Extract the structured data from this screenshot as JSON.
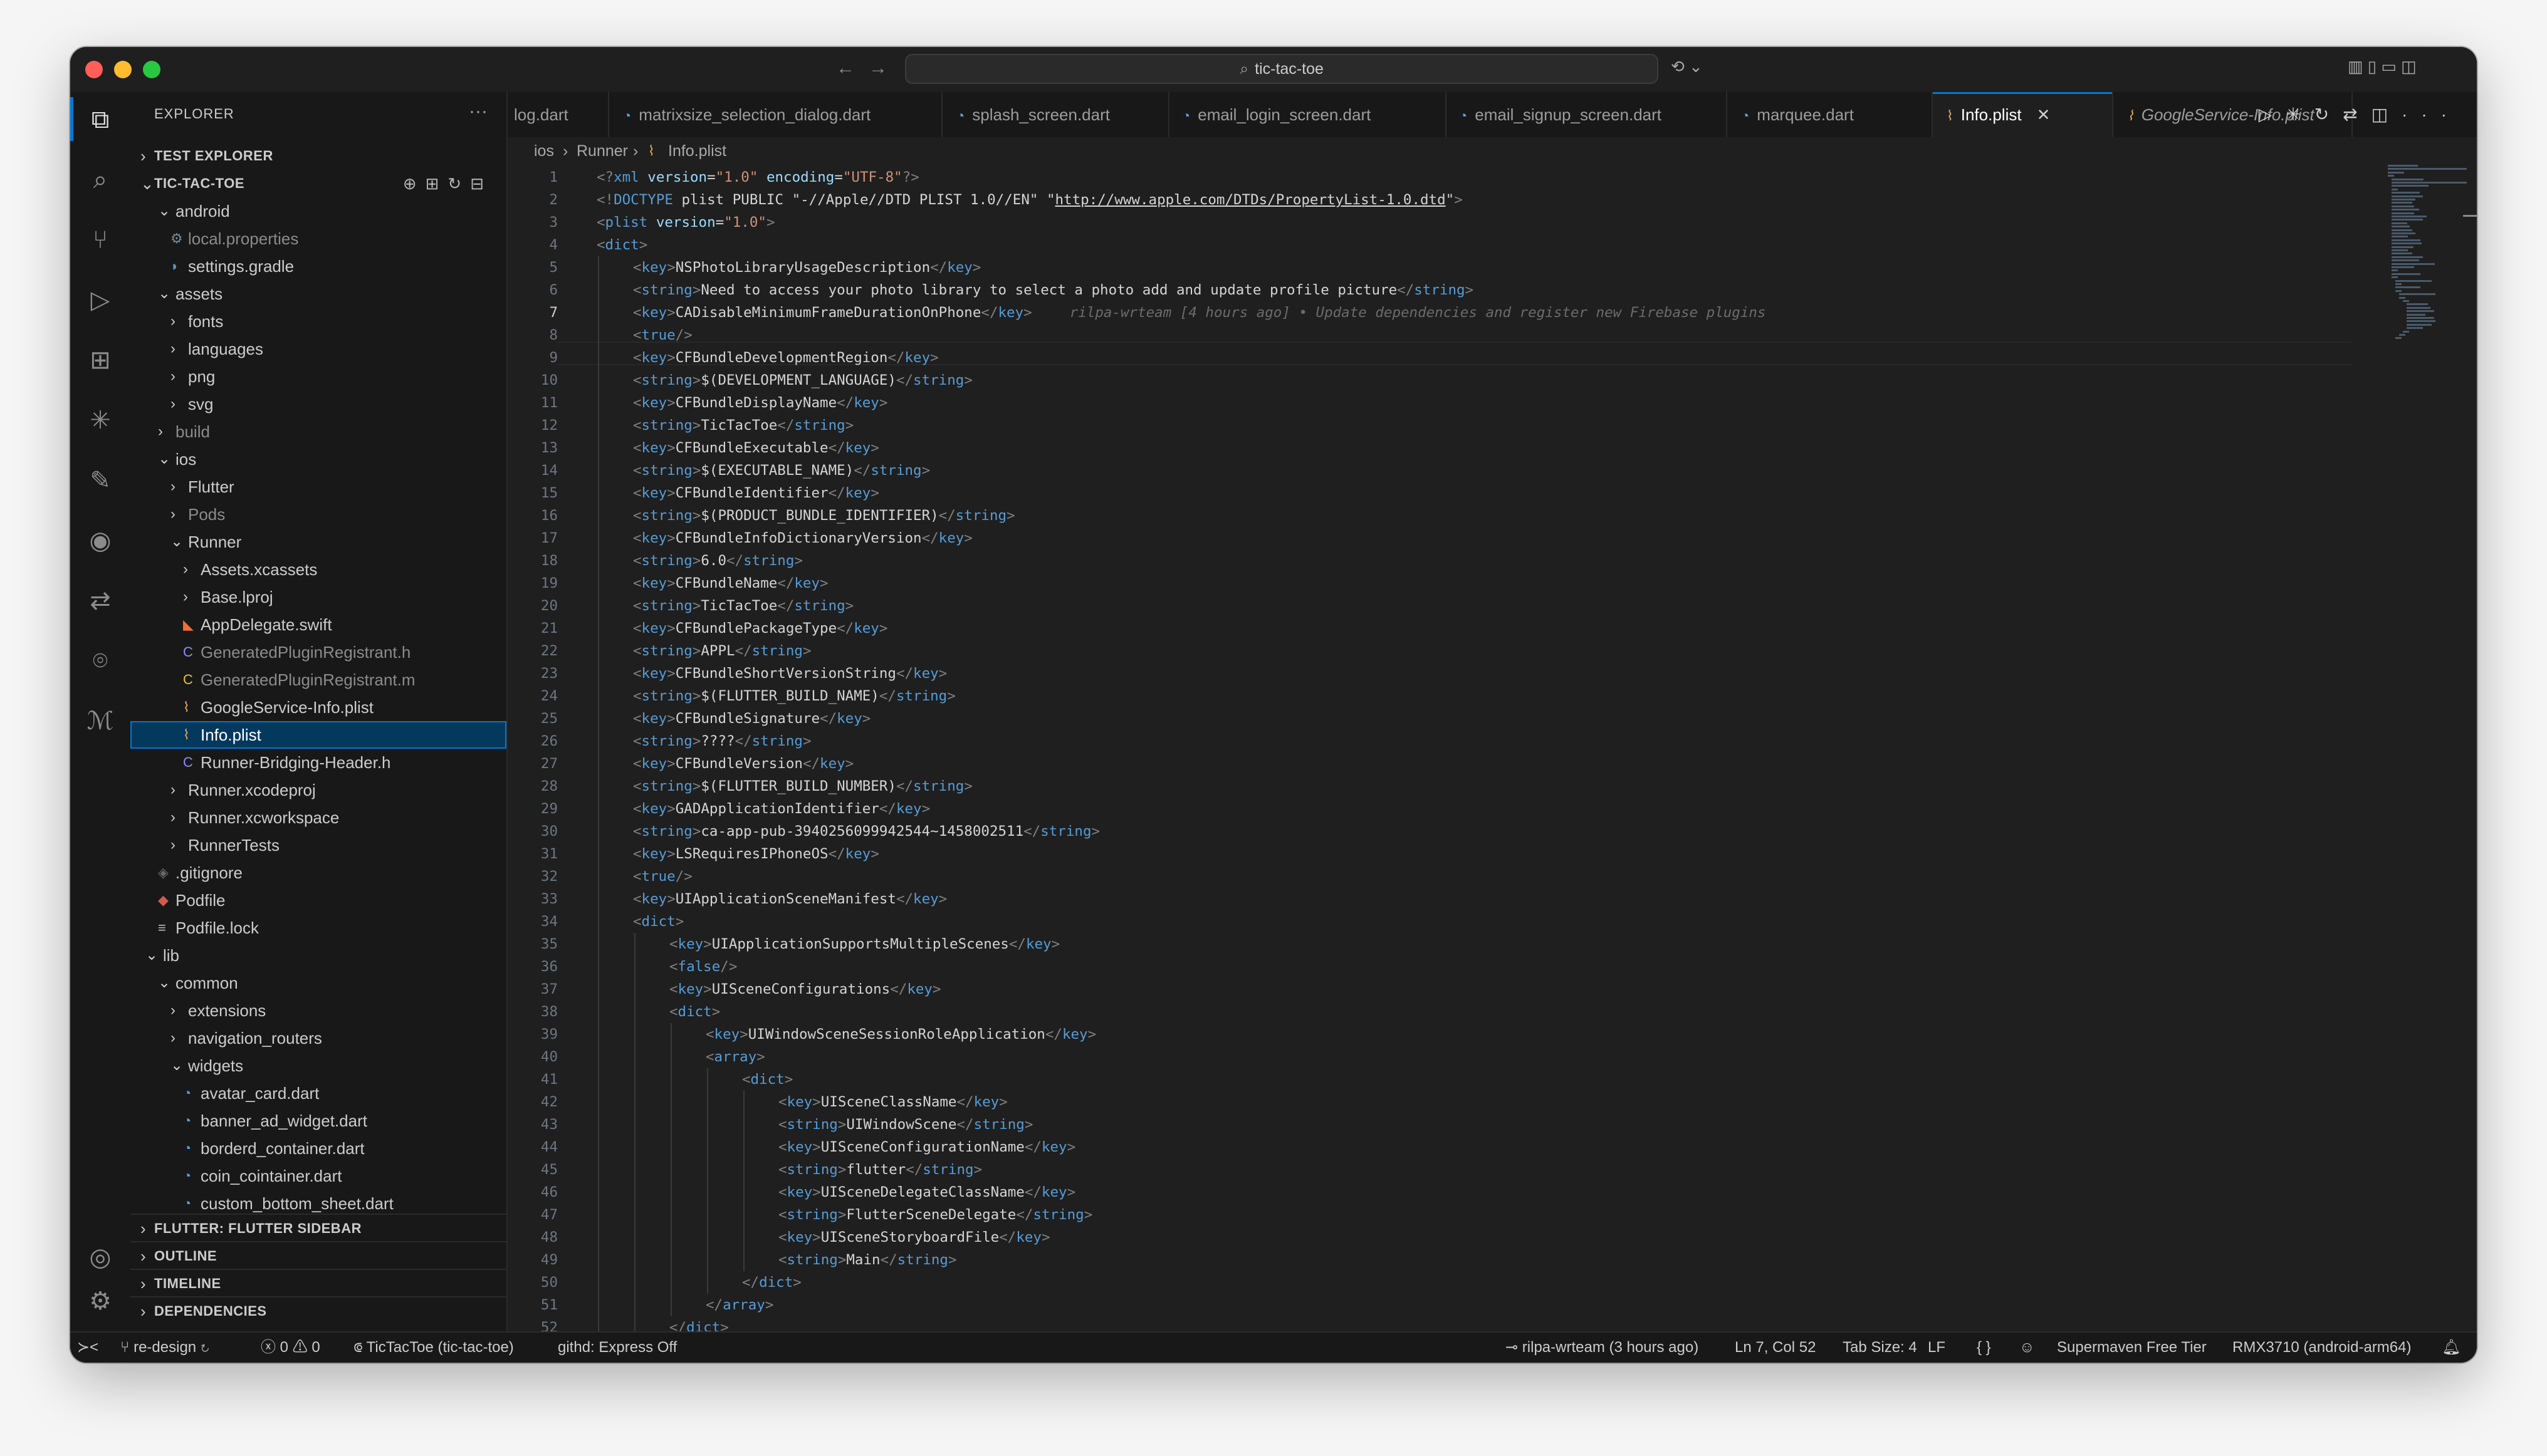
{
  "window": {
    "search": "tic-tac-toe"
  },
  "sidebar": {
    "title": "EXPLORER",
    "sections": {
      "test_explorer": "TEST EXPLORER",
      "project": "TIC-TAC-TOE",
      "flutter_sidebar": "FLUTTER: FLUTTER SIDEBAR",
      "outline": "OUTLINE",
      "timeline": "TIMELINE",
      "dependencies": "DEPENDENCIES"
    },
    "tree": [
      {
        "name": "android",
        "type": "folder-open",
        "depth": 0
      },
      {
        "name": "local.properties",
        "type": "gear-file",
        "depth": 1,
        "dim": true
      },
      {
        "name": "settings.gradle",
        "type": "gradle-file",
        "depth": 1
      },
      {
        "name": "assets",
        "type": "folder-open",
        "depth": 0
      },
      {
        "name": "fonts",
        "type": "folder",
        "depth": 1
      },
      {
        "name": "languages",
        "type": "folder",
        "depth": 1
      },
      {
        "name": "png",
        "type": "folder",
        "depth": 1
      },
      {
        "name": "svg",
        "type": "folder",
        "depth": 1
      },
      {
        "name": "build",
        "type": "folder",
        "depth": 0,
        "dim": true
      },
      {
        "name": "ios",
        "type": "folder-open",
        "depth": 0
      },
      {
        "name": "Flutter",
        "type": "folder",
        "depth": 1
      },
      {
        "name": "Pods",
        "type": "folder",
        "depth": 1,
        "dim": true
      },
      {
        "name": "Runner",
        "type": "folder-open",
        "depth": 1
      },
      {
        "name": "Assets.xcassets",
        "type": "folder",
        "depth": 2
      },
      {
        "name": "Base.lproj",
        "type": "folder",
        "depth": 2
      },
      {
        "name": "AppDelegate.swift",
        "type": "swift-file",
        "depth": 2
      },
      {
        "name": "GeneratedPluginRegistrant.h",
        "type": "c-file",
        "depth": 2,
        "dim": true
      },
      {
        "name": "GeneratedPluginRegistrant.m",
        "type": "c-file-m",
        "depth": 2,
        "dim": true
      },
      {
        "name": "GoogleService-Info.plist",
        "type": "plist-file",
        "depth": 2
      },
      {
        "name": "Info.plist",
        "type": "plist-file",
        "depth": 2,
        "selected": true
      },
      {
        "name": "Runner-Bridging-Header.h",
        "type": "c-file",
        "depth": 2
      },
      {
        "name": "Runner.xcodeproj",
        "type": "folder",
        "depth": 1
      },
      {
        "name": "Runner.xcworkspace",
        "type": "folder",
        "depth": 1
      },
      {
        "name": "RunnerTests",
        "type": "folder",
        "depth": 1
      },
      {
        "name": ".gitignore",
        "type": "git-file",
        "depth": 0
      },
      {
        "name": "Podfile",
        "type": "ruby-file",
        "depth": 0
      },
      {
        "name": "Podfile.lock",
        "type": "lines-file",
        "depth": 0
      },
      {
        "name": "lib",
        "type": "folder-open",
        "depth": -1
      },
      {
        "name": "common",
        "type": "folder-open",
        "depth": 0
      },
      {
        "name": "extensions",
        "type": "folder",
        "depth": 1
      },
      {
        "name": "navigation_routers",
        "type": "folder",
        "depth": 1
      },
      {
        "name": "widgets",
        "type": "folder-open",
        "depth": 1
      },
      {
        "name": "avatar_card.dart",
        "type": "dart-file",
        "depth": 2
      },
      {
        "name": "banner_ad_widget.dart",
        "type": "dart-file",
        "depth": 2
      },
      {
        "name": "borderd_container.dart",
        "type": "dart-file",
        "depth": 2
      },
      {
        "name": "coin_cointainer.dart",
        "type": "dart-file",
        "depth": 2
      },
      {
        "name": "custom_bottom_sheet.dart",
        "type": "dart-file",
        "depth": 2
      }
    ]
  },
  "tabs": [
    {
      "label": "log.dart",
      "icon": "none"
    },
    {
      "label": "matrixsize_selection_dialog.dart",
      "icon": "dart-icon"
    },
    {
      "label": "splash_screen.dart",
      "icon": "dart-icon"
    },
    {
      "label": "email_login_screen.dart",
      "icon": "dart-icon"
    },
    {
      "label": "email_signup_screen.dart",
      "icon": "dart-icon"
    },
    {
      "label": "marquee.dart",
      "icon": "dart-icon"
    },
    {
      "label": "Info.plist",
      "icon": "rss-icon",
      "active": true
    },
    {
      "label": "GoogleService-Info.plist",
      "icon": "rss-icon",
      "italic": true
    }
  ],
  "breadcrumb": [
    "ios",
    "Runner",
    "Info.plist"
  ],
  "editor": {
    "current_line": 7,
    "blame": "rilpa-wrteam [4 hours ago] • Update dependencies and register new Firebase plugins",
    "lines": [
      {
        "n": 1,
        "indent": 0,
        "text": "<?xml version=\"1.0\" encoding=\"UTF-8\"?>"
      },
      {
        "n": 2,
        "indent": 0,
        "text": "<!DOCTYPE plist PUBLIC \"-//Apple//DTD PLIST 1.0//EN\" \"http://www.apple.com/DTDs/PropertyList-1.0.dtd\">"
      },
      {
        "n": 3,
        "indent": 0,
        "text": "<plist version=\"1.0\">"
      },
      {
        "n": 4,
        "indent": 0,
        "text": "<dict>"
      },
      {
        "n": 5,
        "indent": 1,
        "text": "<key>NSPhotoLibraryUsageDescription</key>"
      },
      {
        "n": 6,
        "indent": 1,
        "text": "<string>Need to access your photo library to select a photo add and update profile picture</string>"
      },
      {
        "n": 7,
        "indent": 1,
        "text": "<key>CADisableMinimumFrameDurationOnPhone</key>"
      },
      {
        "n": 8,
        "indent": 1,
        "text": "<true/>"
      },
      {
        "n": 9,
        "indent": 1,
        "text": "<key>CFBundleDevelopmentRegion</key>"
      },
      {
        "n": 10,
        "indent": 1,
        "text": "<string>$(DEVELOPMENT_LANGUAGE)</string>"
      },
      {
        "n": 11,
        "indent": 1,
        "text": "<key>CFBundleDisplayName</key>"
      },
      {
        "n": 12,
        "indent": 1,
        "text": "<string>TicTacToe</string>"
      },
      {
        "n": 13,
        "indent": 1,
        "text": "<key>CFBundleExecutable</key>"
      },
      {
        "n": 14,
        "indent": 1,
        "text": "<string>$(EXECUTABLE_NAME)</string>"
      },
      {
        "n": 15,
        "indent": 1,
        "text": "<key>CFBundleIdentifier</key>"
      },
      {
        "n": 16,
        "indent": 1,
        "text": "<string>$(PRODUCT_BUNDLE_IDENTIFIER)</string>"
      },
      {
        "n": 17,
        "indent": 1,
        "text": "<key>CFBundleInfoDictionaryVersion</key>"
      },
      {
        "n": 18,
        "indent": 1,
        "text": "<string>6.0</string>"
      },
      {
        "n": 19,
        "indent": 1,
        "text": "<key>CFBundleName</key>"
      },
      {
        "n": 20,
        "indent": 1,
        "text": "<string>TicTacToe</string>"
      },
      {
        "n": 21,
        "indent": 1,
        "text": "<key>CFBundlePackageType</key>"
      },
      {
        "n": 22,
        "indent": 1,
        "text": "<string>APPL</string>"
      },
      {
        "n": 23,
        "indent": 1,
        "text": "<key>CFBundleShortVersionString</key>"
      },
      {
        "n": 24,
        "indent": 1,
        "text": "<string>$(FLUTTER_BUILD_NAME)</string>"
      },
      {
        "n": 25,
        "indent": 1,
        "text": "<key>CFBundleSignature</key>"
      },
      {
        "n": 26,
        "indent": 1,
        "text": "<string>????</string>"
      },
      {
        "n": 27,
        "indent": 1,
        "text": "<key>CFBundleVersion</key>"
      },
      {
        "n": 28,
        "indent": 1,
        "text": "<string>$(FLUTTER_BUILD_NUMBER)</string>"
      },
      {
        "n": 29,
        "indent": 1,
        "text": "<key>GADApplicationIdentifier</key>"
      },
      {
        "n": 30,
        "indent": 1,
        "text": "<string>ca-app-pub-3940256099942544~1458002511</string>"
      },
      {
        "n": 31,
        "indent": 1,
        "text": "<key>LSRequiresIPhoneOS</key>"
      },
      {
        "n": 32,
        "indent": 1,
        "text": "<true/>"
      },
      {
        "n": 33,
        "indent": 1,
        "text": "<key>UIApplicationSceneManifest</key>"
      },
      {
        "n": 34,
        "indent": 1,
        "text": "<dict>"
      },
      {
        "n": 35,
        "indent": 2,
        "text": "<key>UIApplicationSupportsMultipleScenes</key>"
      },
      {
        "n": 36,
        "indent": 2,
        "text": "<false/>"
      },
      {
        "n": 37,
        "indent": 2,
        "text": "<key>UISceneConfigurations</key>"
      },
      {
        "n": 38,
        "indent": 2,
        "text": "<dict>"
      },
      {
        "n": 39,
        "indent": 3,
        "text": "<key>UIWindowSceneSessionRoleApplication</key>"
      },
      {
        "n": 40,
        "indent": 3,
        "text": "<array>"
      },
      {
        "n": 41,
        "indent": 4,
        "text": "<dict>"
      },
      {
        "n": 42,
        "indent": 5,
        "text": "<key>UISceneClassName</key>"
      },
      {
        "n": 43,
        "indent": 5,
        "text": "<string>UIWindowScene</string>"
      },
      {
        "n": 44,
        "indent": 5,
        "text": "<key>UISceneConfigurationName</key>"
      },
      {
        "n": 45,
        "indent": 5,
        "text": "<string>flutter</string>"
      },
      {
        "n": 46,
        "indent": 5,
        "text": "<key>UISceneDelegateClassName</key>"
      },
      {
        "n": 47,
        "indent": 5,
        "text": "<string>FlutterSceneDelegate</string>"
      },
      {
        "n": 48,
        "indent": 5,
        "text": "<key>UISceneStoryboardFile</key>"
      },
      {
        "n": 49,
        "indent": 5,
        "text": "<string>Main</string>"
      },
      {
        "n": 50,
        "indent": 4,
        "text": "</dict>"
      },
      {
        "n": 51,
        "indent": 3,
        "text": "</array>"
      },
      {
        "n": 52,
        "indent": 2,
        "text": "</dict>"
      }
    ]
  },
  "status": {
    "branch": "re-design",
    "errors": "0",
    "warnings": "0",
    "project": "TicTacToe (tic-tac-toe)",
    "githd": "githd: Express Off",
    "blame": "rilpa-wrteam (3 hours ago)",
    "cursor": "Ln 7, Col 52",
    "tab_size": "Tab Size: 4",
    "eol": "LF",
    "lang": "{ }",
    "supermaven": "Supermaven Free Tier",
    "device": "RMX3710 (android-arm64)"
  },
  "colors": {
    "accent": "#0078d4",
    "editor_bg": "#1f1f1f",
    "chrome_bg": "#181818",
    "tag": "#569cd6",
    "attr": "#9cdcfe",
    "string": "#ce9178"
  }
}
